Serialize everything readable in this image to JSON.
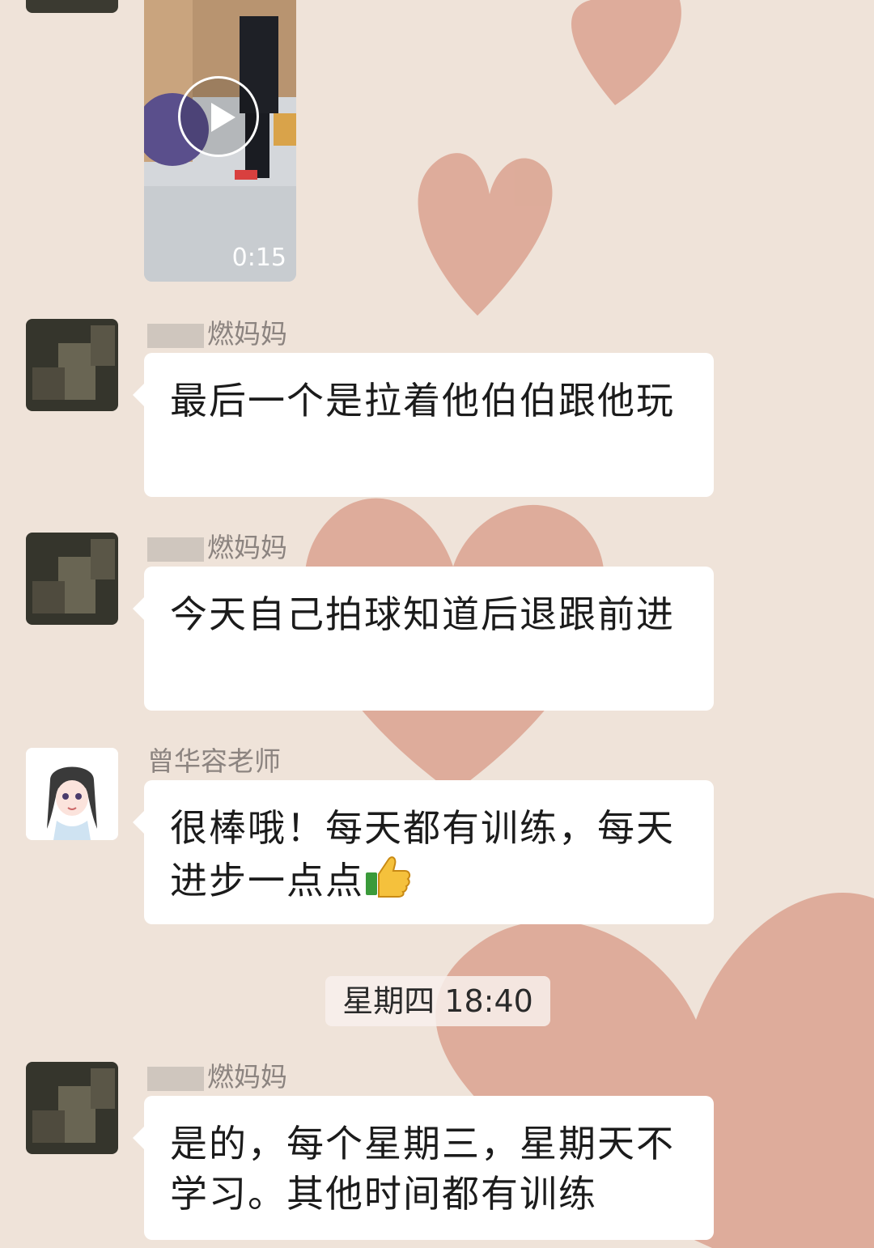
{
  "colors": {
    "background": "#efe3d9",
    "heart": "#d89a86",
    "bubble": "#ffffff"
  },
  "video": {
    "duration": "0:15",
    "icon": "play-icon"
  },
  "messages": [
    {
      "sender": "燃妈妈",
      "text": "最后一个是拉着他伯伯跟他玩"
    },
    {
      "sender": "燃妈妈",
      "text": "今天自己拍球知道后退跟前进"
    },
    {
      "sender": "曾华容老师",
      "text": "很棒哦！每天都有训练，每天进步一点点",
      "emoji": "thumbs-up-icon"
    },
    {
      "sender": "燃妈妈",
      "text": "是的，每个星期三，星期天不学习。其他时间都有训练"
    }
  ],
  "timestamp": "星期四 18:40"
}
